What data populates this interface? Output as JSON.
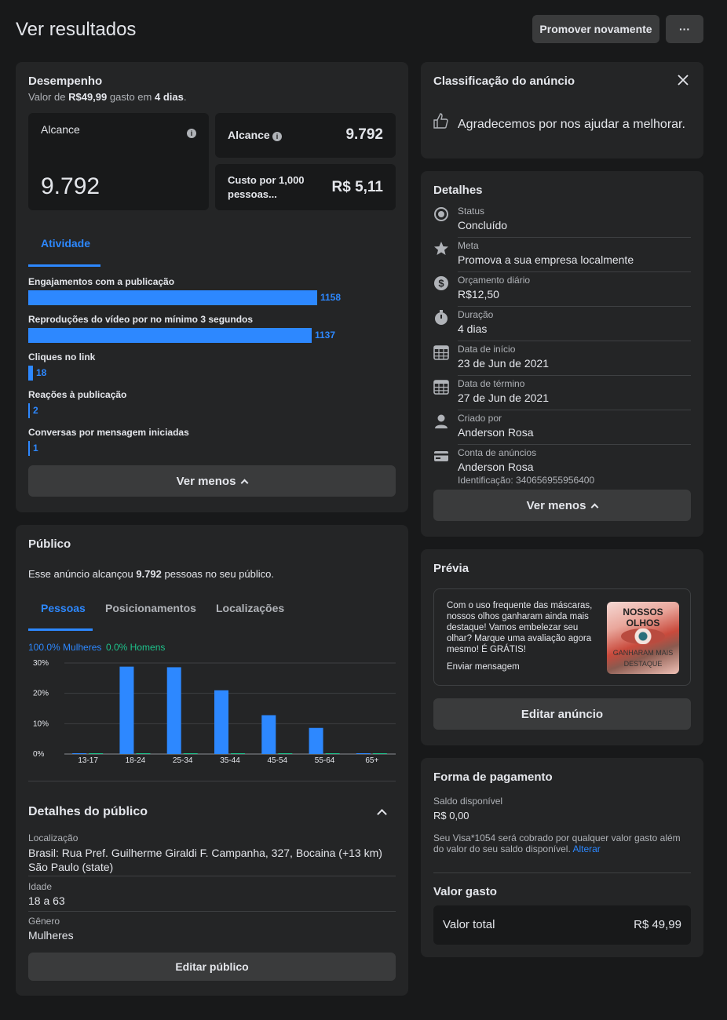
{
  "header": {
    "title": "Ver resultados",
    "promote_label": "Promover novamente",
    "more_label": "···"
  },
  "performance": {
    "title": "Desempenho",
    "subtitle_prefix": "Valor de",
    "spent": "R$49,99",
    "subtitle_mid": "gasto em",
    "days": "4 dias",
    "subtitle_end": ".",
    "reach_label": "Alcance",
    "reach_value": "9.792",
    "reach_small_label": "Alcance",
    "reach_small_value": "9.792",
    "cost_label": "Custo por 1,000 pessoas...",
    "cost_value": "R$ 5,11",
    "tab_activity": "Atividade",
    "activity": [
      {
        "label": "Engajamentos com a publicação",
        "value": 1158
      },
      {
        "label": "Reproduções do vídeo por no mínimo 3 segundos",
        "value": 1137
      },
      {
        "label": "Cliques no link",
        "value": 18
      },
      {
        "label": "Reações à publicação",
        "value": 2
      },
      {
        "label": "Conversas por mensagem iniciadas",
        "value": 1
      }
    ],
    "see_less": "Ver menos"
  },
  "rating": {
    "title": "Classificação do anúncio",
    "thanks": "Agradecemos por nos ajudar a melhorar."
  },
  "details": {
    "title": "Detalhes",
    "rows": [
      {
        "icon": "status-icon",
        "label": "Status",
        "value": "Concluído"
      },
      {
        "icon": "star-icon",
        "label": "Meta",
        "value": "Promova a sua empresa localmente"
      },
      {
        "icon": "dollar-icon",
        "label": "Orçamento diário",
        "value": "R$12,50"
      },
      {
        "icon": "timer-icon",
        "label": "Duração",
        "value": "4 dias"
      },
      {
        "icon": "calendar-icon",
        "label": "Data de início",
        "value": "23 de Jun de 2021"
      },
      {
        "icon": "calendar-icon",
        "label": "Data de término",
        "value": "27 de Jun de 2021"
      },
      {
        "icon": "person-icon",
        "label": "Criado por",
        "value": "Anderson Rosa"
      },
      {
        "icon": "card-icon",
        "label": "Conta de anúncios",
        "value": "Anderson Rosa"
      }
    ],
    "account_id": "Identificação: 340656955956400",
    "see_less": "Ver menos"
  },
  "preview": {
    "title": "Prévia",
    "text": "Com o uso frequente das máscaras, nossos olhos ganharam ainda mais destaque! Vamos embelezar seu olhar? Marque uma avaliação agora mesmo! É GRÁTIS!",
    "cta": "Enviar mensagem",
    "thumb_top": "NOSSOS OLHOS",
    "thumb_bottom": "GANHARAM MAIS DESTAQUE",
    "edit_label": "Editar anúncio"
  },
  "payment": {
    "title": "Forma de pagamento",
    "balance_label": "Saldo disponível",
    "balance_value": "R$ 0,00",
    "note": "Seu Visa*1054 será cobrado por qualquer valor gasto além do valor do seu saldo disponível.",
    "alter_label": "Alterar",
    "spent_title": "Valor gasto",
    "total_label": "Valor total",
    "total_value": "R$ 49,99"
  },
  "audience": {
    "title": "Público",
    "reach_prefix": "Esse anúncio alcançou",
    "reach_value": "9.792",
    "reach_suffix": "pessoas no seu público.",
    "tabs": [
      "Pessoas",
      "Posicionamentos",
      "Localizações"
    ],
    "legend_women": "100.0% Mulheres",
    "legend_men": "0.0% Homens",
    "details_title": "Detalhes do público",
    "location_label": "Localização",
    "location_value": "Brasil: Rua Pref. Guilherme Giraldi F. Campanha, 327, Bocaina (+13 km) São Paulo (state)",
    "age_label": "Idade",
    "age_value": "18 a 63",
    "gender_label": "Gênero",
    "gender_value": "Mulheres",
    "edit_label": "Editar público"
  },
  "colors": {
    "accent": "#2d88ff",
    "men": "#1ec28b"
  },
  "chart_data": {
    "type": "bar",
    "categories": [
      "13-17",
      "18-24",
      "25-34",
      "35-44",
      "45-54",
      "55-64",
      "65+"
    ],
    "series": [
      {
        "name": "Mulheres",
        "values": [
          0.2,
          28.8,
          28.6,
          21,
          12.8,
          8.6,
          0.2
        ]
      },
      {
        "name": "Homens",
        "values": [
          0,
          0,
          0,
          0,
          0,
          0,
          0
        ]
      }
    ],
    "yticks": [
      "0%",
      "10%",
      "20%",
      "30%"
    ],
    "ylim": [
      0,
      30
    ]
  }
}
